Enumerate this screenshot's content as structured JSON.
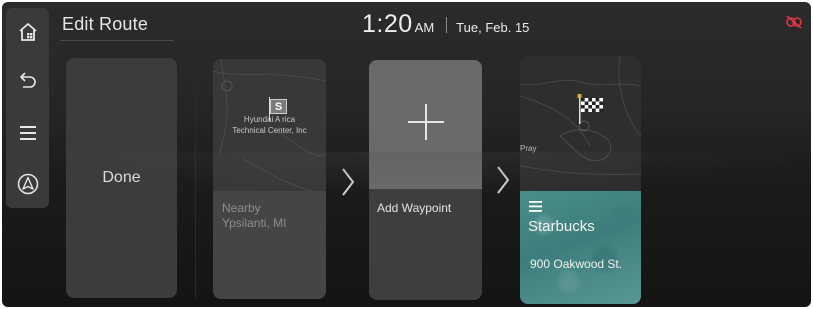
{
  "header": {
    "title": "Edit Route",
    "time": "1:20",
    "ampm": "AM",
    "date": "Tue, Feb. 15"
  },
  "nav": [
    {
      "name": "home-icon"
    },
    {
      "name": "back-icon"
    },
    {
      "name": "menu-icon"
    },
    {
      "name": "navigation-icon"
    }
  ],
  "route": {
    "done_label": "Done",
    "start": {
      "marker": "S",
      "map_label_line1": "Hyundai A  rica",
      "map_label_line2": "Technical Center, Inc",
      "nearby_line1": "Nearby",
      "nearby_line2": "Ypsilanti, MI"
    },
    "add_waypoint_label": "Add Waypoint",
    "destination": {
      "map_label": "Pray",
      "name": "Starbucks",
      "address": "900 Oakwood St."
    }
  },
  "colors": {
    "background": "#222222",
    "rail": "#3a3a3a",
    "destination_card": "#4b8e89",
    "status_icon": "#d9363e"
  }
}
